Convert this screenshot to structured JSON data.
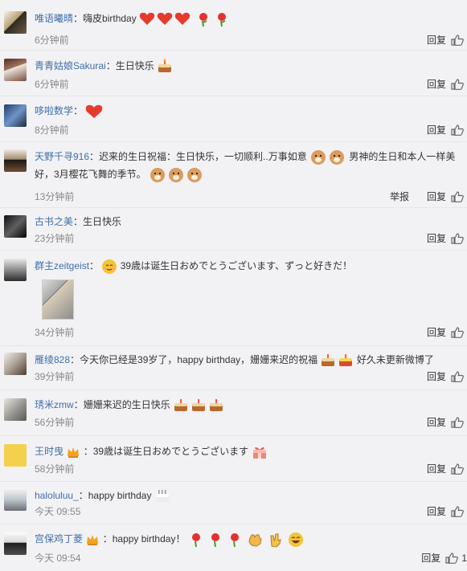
{
  "colors": {
    "username": "#3f6ea9",
    "meta": "#888888",
    "text": "#333333",
    "background": "#f2f2f5"
  },
  "comments": [
    {
      "user": "唯语曦晴",
      "colon": "：",
      "text": "嗨皮birthday",
      "time": "6分钟前",
      "reply": "回复",
      "emojis": [
        "heart-icon",
        "heart-icon",
        "heart-icon",
        "rose-icon",
        "rose-icon"
      ]
    },
    {
      "user": "青青姑娘Sakurai",
      "colon": "：",
      "text": "生日快乐",
      "time": "6分钟前",
      "reply": "回复",
      "emojis": [
        "cake-icon"
      ]
    },
    {
      "user": "哆啦数学",
      "colon": "：",
      "text": "",
      "time": "8分钟前",
      "reply": "回复",
      "emojis": [
        "heart-icon"
      ]
    },
    {
      "user": "天野千寻916",
      "colon": "：",
      "text": "迟来的生日祝福：生日快乐，一切顺利..万事如意",
      "text2": "男神的生日和本人一样美",
      "text3": "好，3月樱花飞舞的季节。",
      "time": "13分钟前",
      "report": "举报",
      "reply": "回复",
      "emojis": [
        "doge-icon",
        "doge-icon",
        "doge-icon",
        "doge-icon",
        "doge-icon"
      ]
    },
    {
      "user": "古书之美",
      "colon": "：",
      "text": "生日快乐",
      "time": "23分钟前",
      "reply": "回复",
      "emojis": []
    },
    {
      "user": "群主zeitgeist",
      "colon": "：",
      "text": "39歳は诞生日おめでとうございます、ずっと好きだ！",
      "time": "34分钟前",
      "reply": "回复",
      "emojis": [
        "blush-icon"
      ]
    },
    {
      "user": "雁绫828",
      "colon": "：",
      "text": "今天你已经是39岁了，happy birthday，姗姗来迟的祝福",
      "text2": "好久未更新微博了",
      "time": "39分钟前",
      "reply": "回复",
      "emojis": [
        "cake-icon",
        "cake-icon"
      ]
    },
    {
      "user": "琇米zmw",
      "colon": "：",
      "text": "姗姗来迟的生日快乐",
      "time": "56分钟前",
      "reply": "回复",
      "emojis": [
        "cake-icon",
        "cake-icon",
        "cake-icon"
      ]
    },
    {
      "user": "王时曳",
      "colon": "：",
      "text": "39歳は诞生日おめでとうございます",
      "time": "58分钟前",
      "reply": "回复",
      "emojis": [
        "crown-icon",
        "gift-icon"
      ]
    },
    {
      "user": "haloluluu_",
      "colon": "：",
      "text": "happy birthday",
      "time": "今天 09:55",
      "reply": "回复",
      "emojis": [
        "cake-icon"
      ]
    },
    {
      "user": "宫保鸡丁菱",
      "colon": "：",
      "text": "happy birthday！",
      "time": "今天 09:54",
      "reply": "回复",
      "likes": "1",
      "emojis": [
        "crown-icon",
        "rose-icon",
        "rose-icon",
        "rose-icon",
        "fist-icon",
        "rock-icon",
        "laugh-icon"
      ]
    }
  ]
}
